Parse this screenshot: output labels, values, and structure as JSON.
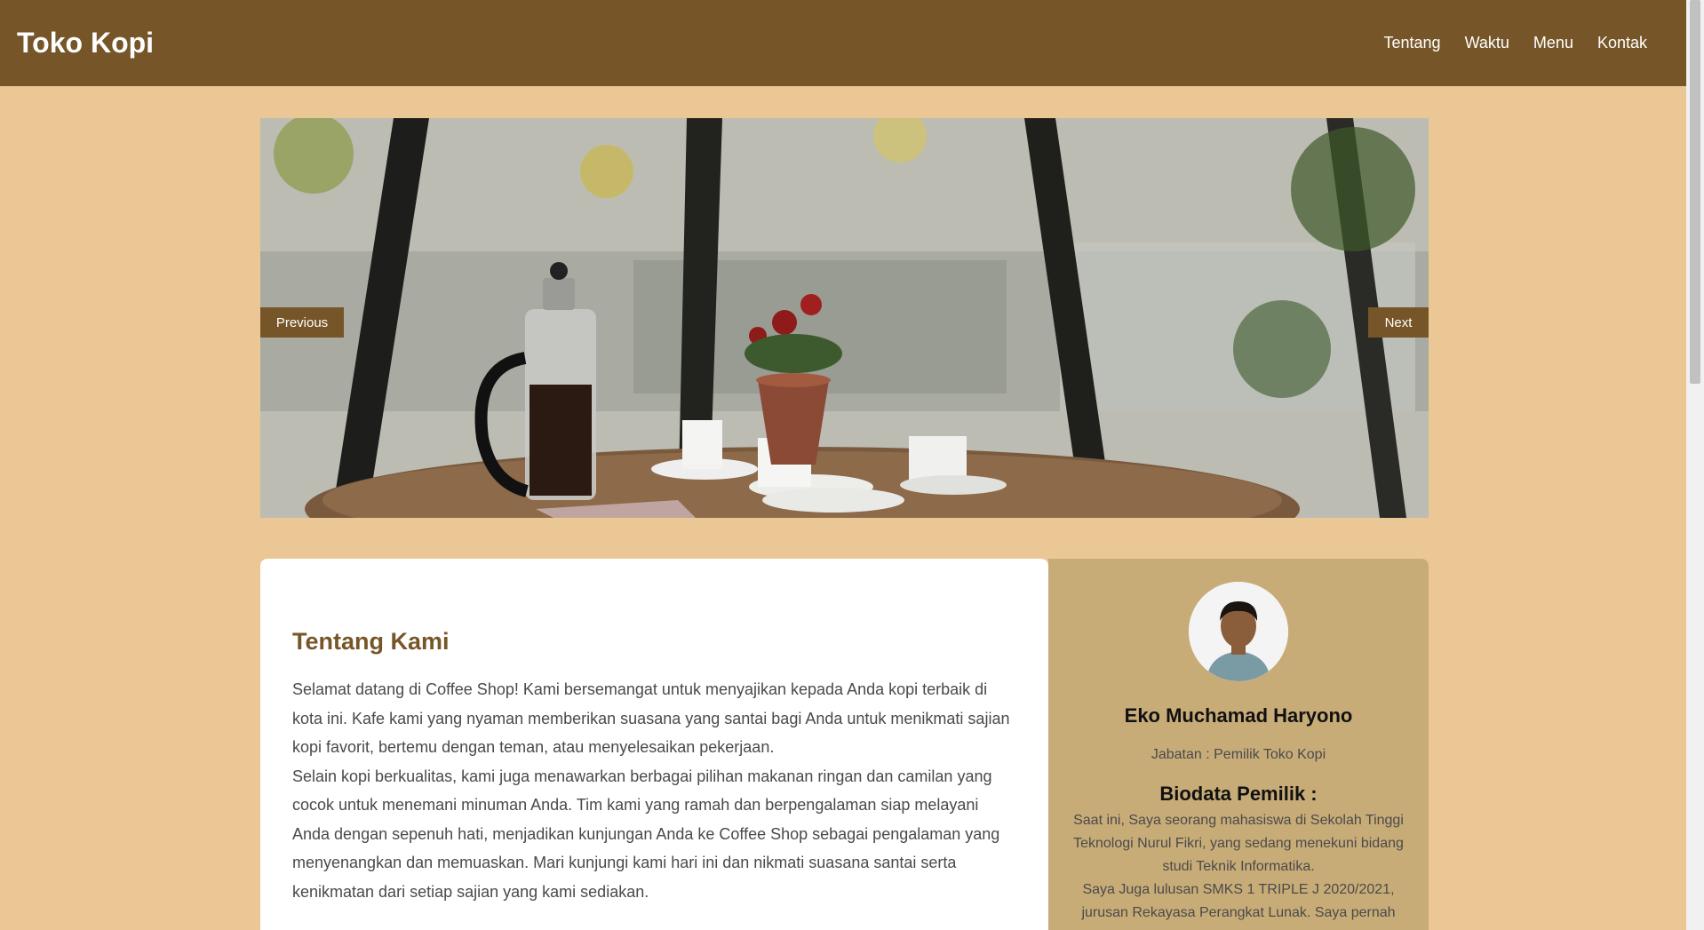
{
  "nav": {
    "brand": "Toko Kopi",
    "links": [
      "Tentang",
      "Waktu",
      "Menu",
      "Kontak"
    ]
  },
  "carousel": {
    "prev_label": "Previous",
    "next_label": "Next"
  },
  "about": {
    "title": "Tentang Kami",
    "paragraph": "Selamat datang di Coffee Shop! Kami bersemangat untuk menyajikan kepada Anda kopi terbaik di kota ini. Kafe kami yang nyaman memberikan suasana yang santai bagi Anda untuk menikmati sajian kopi favorit, bertemu dengan teman, atau menyelesaikan pekerjaan.",
    "paragraph2": "Selain kopi berkualitas, kami juga menawarkan berbagai pilihan makanan ringan dan camilan yang cocok untuk menemani minuman Anda. Tim kami yang ramah dan berpengalaman siap melayani Anda dengan sepenuh hati, menjadikan kunjungan Anda ke Coffee Shop sebagai pengalaman yang menyenangkan dan memuaskan. Mari kunjungi kami hari ini dan nikmati suasana santai serta kenikmatan dari setiap sajian yang kami sediakan."
  },
  "profile": {
    "name": "Eko Muchamad Haryono",
    "role": "Jabatan : Pemilik Toko Kopi",
    "bio_title": "Biodata Pemilik :",
    "bio_1": "Saat ini, Saya seorang mahasiswa di Sekolah Tinggi Teknologi Nurul Fikri, yang sedang menekuni bidang studi Teknik Informatika.",
    "bio_2": "Saya Juga lulusan SMKS 1 TRIPLE J 2020/2021, jurusan Rekayasa Perangkat Lunak. Saya pernah"
  },
  "colors": {
    "nav_bg": "#765628",
    "page_bg": "#ECC796",
    "profile_bg": "#C8AC78",
    "accent_text": "#765628"
  }
}
